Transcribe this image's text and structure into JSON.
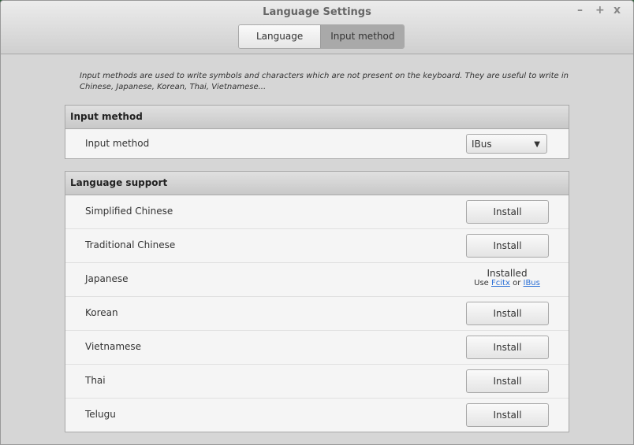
{
  "window": {
    "title": "Language Settings",
    "controls": [
      "–",
      "+",
      "x"
    ]
  },
  "tabs": [
    "Language",
    "Input method"
  ],
  "description": "Input methods are used to write symbols and characters which are not present on the keyboard. They are useful to write in Chinese, Japanese, Korean, Thai, Vietnamese...",
  "input_section": {
    "header": "Input method",
    "label": "Input method",
    "value": "IBus"
  },
  "support_section": {
    "header": "Language support",
    "install_label": "Install",
    "rows": [
      {
        "name": "Simplified Chinese"
      },
      {
        "name": "Traditional Chinese"
      },
      {
        "name": "Japanese",
        "status": "Installed",
        "use": "Use",
        "link1": "Fcitx",
        "or": "or",
        "link2": "IBus"
      },
      {
        "name": "Korean"
      },
      {
        "name": "Vietnamese"
      },
      {
        "name": "Thai"
      },
      {
        "name": "Telugu"
      }
    ]
  }
}
